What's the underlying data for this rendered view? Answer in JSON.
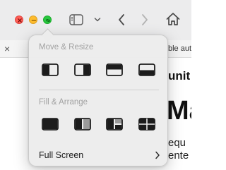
{
  "window": {
    "traffic_lights": {
      "close_color": "#ff5f57",
      "minimize_color": "#febc2e",
      "zoom_color": "#28c840"
    },
    "toolbar_icons": [
      "sidebar-icon",
      "chevron-down-icon",
      "back-arrow-icon",
      "forward-arrow-icon",
      "home-icon"
    ]
  },
  "tab": {
    "close_glyph": "×",
    "title_fragment": "ble auto"
  },
  "page": {
    "heading_fragment": "unit",
    "big_heading_fragment": "Ma",
    "line1_fragment": "equ",
    "line2_fragment": "ente"
  },
  "popover": {
    "move_section_label": "Move & Resize",
    "move_actions": [
      {
        "icon": "tile-left-half-icon"
      },
      {
        "icon": "tile-right-half-icon"
      },
      {
        "icon": "tile-top-half-icon"
      },
      {
        "icon": "tile-bottom-half-icon"
      }
    ],
    "fill_section_label": "Fill & Arrange",
    "fill_actions": [
      {
        "icon": "fill-screen-icon"
      },
      {
        "icon": "arrange-left-right-icon"
      },
      {
        "icon": "arrange-left-quarters-icon"
      },
      {
        "icon": "arrange-quarters-icon"
      }
    ],
    "full_screen_label": "Full Screen",
    "full_screen_chevron": "chevron-right-icon"
  }
}
